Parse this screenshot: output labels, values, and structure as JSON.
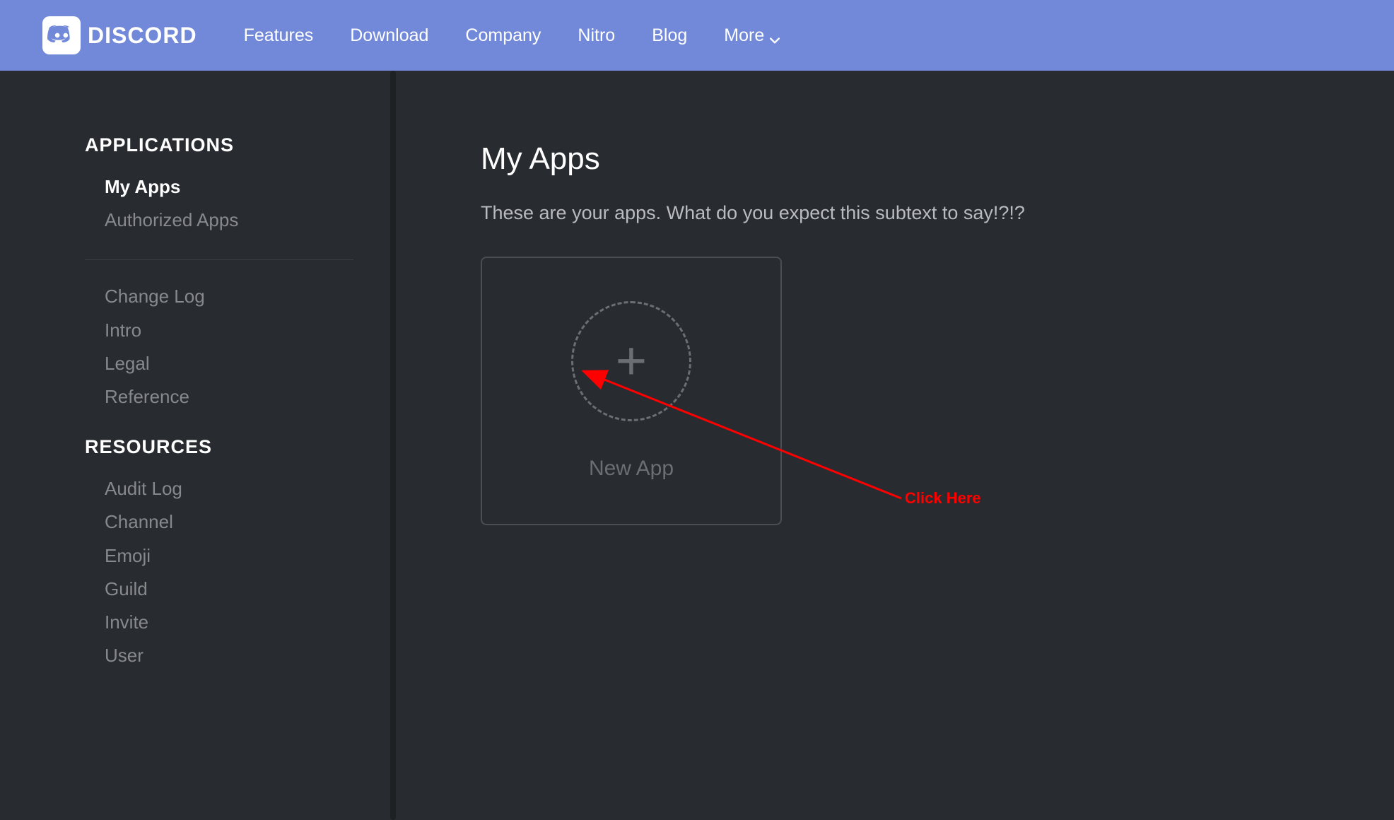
{
  "brand": {
    "name": "DISCORD"
  },
  "nav": {
    "items": [
      {
        "label": "Features"
      },
      {
        "label": "Download"
      },
      {
        "label": "Company"
      },
      {
        "label": "Nitro"
      },
      {
        "label": "Blog"
      },
      {
        "label": "More"
      }
    ]
  },
  "sidebar": {
    "applications": {
      "heading": "APPLICATIONS",
      "items": [
        {
          "label": "My Apps",
          "active": true
        },
        {
          "label": "Authorized Apps",
          "active": false
        }
      ]
    },
    "docs_group": {
      "items": [
        {
          "label": "Change Log"
        },
        {
          "label": "Intro"
        },
        {
          "label": "Legal"
        },
        {
          "label": "Reference"
        }
      ]
    },
    "resources": {
      "heading": "RESOURCES",
      "items": [
        {
          "label": "Audit Log"
        },
        {
          "label": "Channel"
        },
        {
          "label": "Emoji"
        },
        {
          "label": "Guild"
        },
        {
          "label": "Invite"
        },
        {
          "label": "User"
        }
      ]
    }
  },
  "main": {
    "title": "My Apps",
    "subtext": "These are your apps. What do you expect this subtext to say!?!?",
    "newapp_label": "New App"
  },
  "annotation": {
    "label": "Click Here"
  }
}
